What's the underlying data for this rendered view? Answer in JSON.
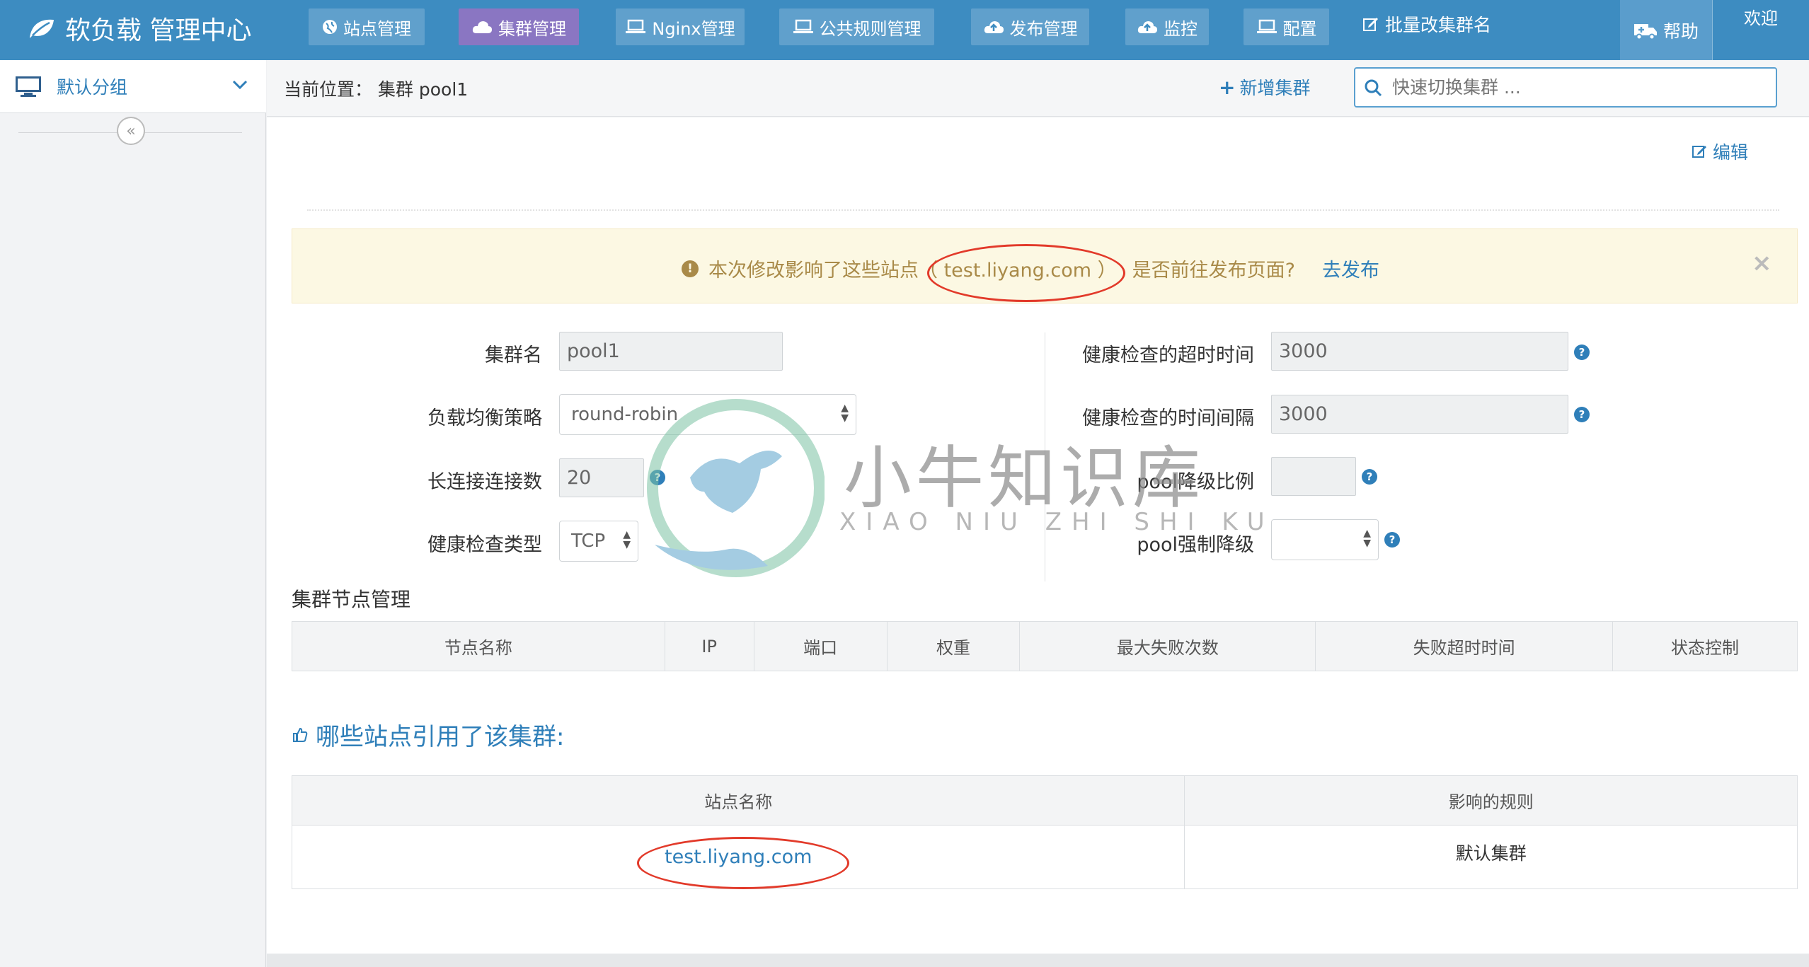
{
  "app": {
    "brand": "软负载 管理中心"
  },
  "nav": {
    "items": [
      {
        "label": "站点管理"
      },
      {
        "label": "集群管理"
      },
      {
        "label": "Nginx管理"
      },
      {
        "label": "公共规则管理"
      },
      {
        "label": "发布管理"
      },
      {
        "label": "监控"
      },
      {
        "label": "配置"
      },
      {
        "label": "批量改集群名"
      }
    ],
    "help": "帮助",
    "welcome": "欢迎"
  },
  "sidebar": {
    "group_label": "默认分组",
    "collapse_glyph": "«"
  },
  "breadcrumb": {
    "text": "当前位置：  集群 pool1"
  },
  "toolbar": {
    "add_cluster": "新增集群",
    "search_placeholder": "快速切换集群 ..."
  },
  "main": {
    "edit": "编辑"
  },
  "alert": {
    "prefix": "本次修改影响了这些站点",
    "sites": "（ test.liyang.com ）",
    "question": "是否前往发布页面?",
    "link": "去发布",
    "close": "×"
  },
  "form": {
    "cluster_name": {
      "label": "集群名",
      "value": "pool1"
    },
    "lb_strategy": {
      "label": "负载均衡策略",
      "value": "round-robin"
    },
    "keepalive": {
      "label": "长连接连接数",
      "value": "20"
    },
    "hc_type": {
      "label": "健康检查类型",
      "value": "TCP"
    },
    "hc_timeout": {
      "label": "健康检查的超时时间",
      "value": "3000"
    },
    "hc_interval": {
      "label": "健康检查的时间间隔",
      "value": "3000"
    },
    "pool_ratio": {
      "label": "pool降级比例",
      "value": ""
    },
    "pool_force": {
      "label": "pool强制降级",
      "value": ""
    }
  },
  "nodes": {
    "title": "集群节点管理",
    "columns": [
      "节点名称",
      "IP",
      "端口",
      "权重",
      "最大失败次数",
      "失败超时时间",
      "状态控制"
    ]
  },
  "refs": {
    "title": "哪些站点引用了该集群:",
    "columns": [
      "站点名称",
      "影响的规则"
    ],
    "rows": [
      {
        "site": "test.liyang.com",
        "rule": "默认集群"
      }
    ]
  },
  "watermark": {
    "name": "小牛知识库",
    "pinyin": "XIAO NIU ZHI SHI KU"
  },
  "colors": {
    "nav_bg": "#3d8cc1",
    "active_nav": "#8a76c2",
    "link": "#2f7fb9",
    "alert_bg": "#fcf8e3",
    "annotation_red": "#e23a2a"
  }
}
